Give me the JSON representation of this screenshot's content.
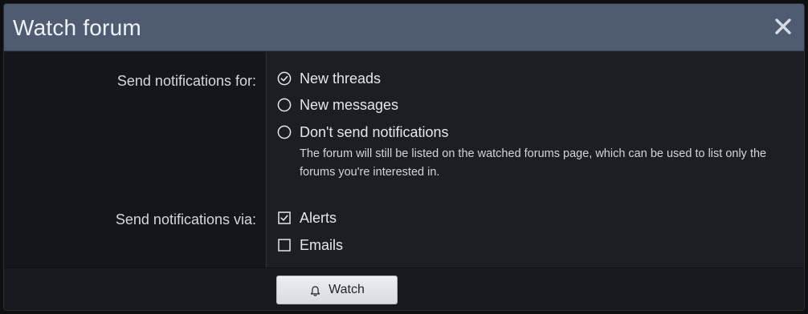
{
  "dialog": {
    "title": "Watch forum",
    "close_icon": "close-icon"
  },
  "notifications_for": {
    "label": "Send notifications for:",
    "options": [
      {
        "label": "New threads",
        "selected": true
      },
      {
        "label": "New messages",
        "selected": false
      },
      {
        "label": "Don't send notifications",
        "selected": false
      }
    ],
    "hint": "The forum will still be listed on the watched forums page, which can be used to list only the forums you're interested in."
  },
  "notifications_via": {
    "label": "Send notifications via:",
    "options": [
      {
        "label": "Alerts",
        "checked": true
      },
      {
        "label": "Emails",
        "checked": false
      }
    ]
  },
  "footer": {
    "watch_label": "Watch",
    "watch_icon": "bell-icon"
  },
  "colors": {
    "header": "#4e5b71",
    "body": "#1b1e24",
    "label_column": "#14161b",
    "button": "#e3e5e9"
  }
}
